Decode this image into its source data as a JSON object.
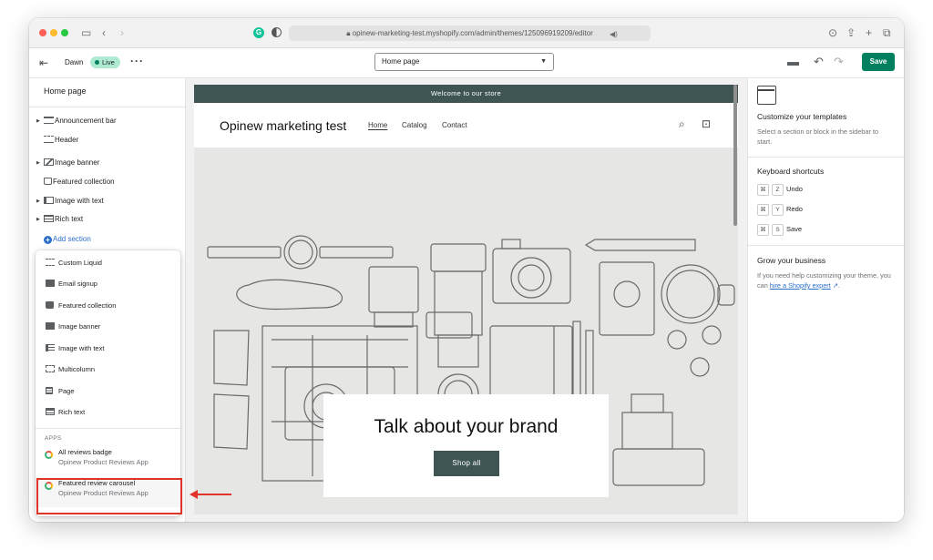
{
  "browser": {
    "url": "opinew-marketing-test.myshopify.com/admin/themes/125096919209/editor"
  },
  "toolbar": {
    "theme_name": "Dawn",
    "live_badge": "Live",
    "page_select": "Home page",
    "save_label": "Save"
  },
  "sidebar": {
    "title": "Home page",
    "sections": [
      {
        "label": "Announcement bar",
        "icon": "announcement-bar-icon",
        "expandable": true
      },
      {
        "label": "Header",
        "icon": "header-icon",
        "expandable": false
      },
      {
        "label": "Image banner",
        "icon": "image-icon",
        "expandable": true
      },
      {
        "label": "Featured collection",
        "icon": "bag-icon",
        "expandable": false
      },
      {
        "label": "Image with text",
        "icon": "image-with-text-icon",
        "expandable": true
      },
      {
        "label": "Rich text",
        "icon": "rich-text-icon",
        "expandable": true
      }
    ],
    "add_section": "Add section"
  },
  "popover": {
    "items": [
      {
        "label": "Custom Liquid",
        "icon": "custom-liquid-icon"
      },
      {
        "label": "Email signup",
        "icon": "email-icon"
      },
      {
        "label": "Featured collection",
        "icon": "bag-icon"
      },
      {
        "label": "Image banner",
        "icon": "image-icon"
      },
      {
        "label": "Image with text",
        "icon": "image-with-text-icon"
      },
      {
        "label": "Multicolumn",
        "icon": "multicolumn-icon"
      },
      {
        "label": "Page",
        "icon": "page-icon"
      },
      {
        "label": "Rich text",
        "icon": "rich-text-icon"
      }
    ],
    "apps_label": "APPS",
    "apps": [
      {
        "name": "All reviews badge",
        "sub": "Opinew Product Reviews App"
      },
      {
        "name": "Featured review carousel",
        "sub": "Opinew Product Reviews App"
      }
    ]
  },
  "preview": {
    "announcement": "Welcome to our store",
    "store_name": "Opinew marketing test",
    "nav": [
      "Home",
      "Catalog",
      "Contact"
    ],
    "hero_title": "Talk about your brand",
    "hero_button": "Shop all"
  },
  "right_panel": {
    "customize_title": "Customize your templates",
    "customize_text": "Select a section or block in the sidebar to start.",
    "shortcuts_title": "Keyboard shortcuts",
    "shortcuts": [
      {
        "mod": "⌘",
        "key": "Z",
        "action": "Undo"
      },
      {
        "mod": "⌘",
        "key": "Y",
        "action": "Redo"
      },
      {
        "mod": "⌘",
        "key": "S",
        "action": "Save"
      }
    ],
    "grow_title": "Grow your business",
    "grow_text_before": "If you need help customizing your theme, you can",
    "grow_link": "hire a Shopify expert",
    "grow_text_after": "."
  },
  "colors": {
    "accent_save": "#008060",
    "announcement_bg": "#3f5553",
    "highlight": "#e0342a",
    "link": "#2c6ecb"
  }
}
